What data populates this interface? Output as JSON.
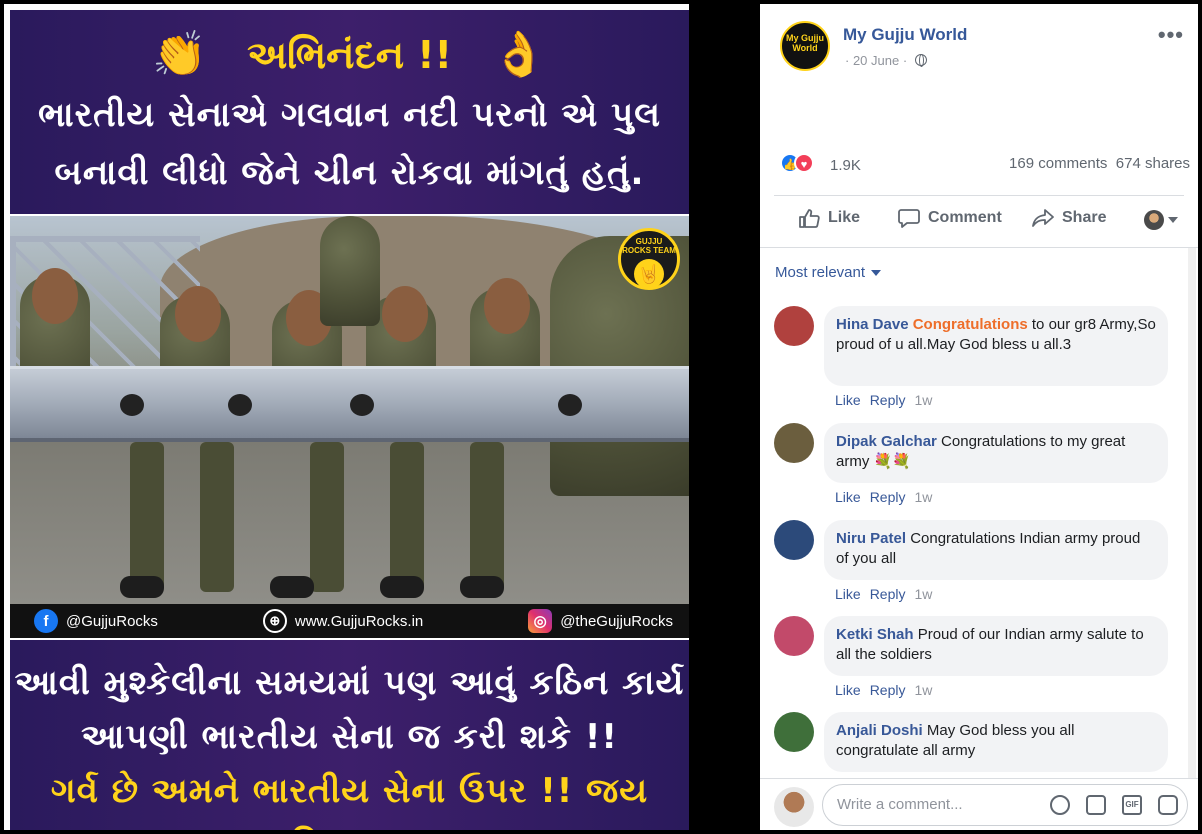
{
  "image": {
    "emoji_left": "👏",
    "emoji_right": "👌",
    "headline": "અભિનંદન !!",
    "line1": "ભારતીય સેનાએ ગલવાન નદી પરનો એ પુલ",
    "line2": "બનાવી લીધો જેને ચીન રોકવા માંગતું હતું.",
    "badge_text": "GUJJU ROCKS TEAM",
    "social_facebook": "@GujjuRocks",
    "social_web": "www.GujjuRocks.in",
    "social_instagram": "@theGujjuRocks",
    "bottom_line1": "આવી મુશ્કેલીના સમયમાં પણ આવું કઠિન કાર્ય",
    "bottom_line2": "આપણી ભારતીય સેના જ કરી શકે !!",
    "bottom_line3": "ગર્વ છે અમને ભારતીય સેના ઉપર !! જય હિન્દ !!"
  },
  "post": {
    "page_avatar_text": "My Gujju World",
    "page_name": "My Gujju World",
    "date": "· 20 June ·",
    "more": "•••",
    "reactions_count": "1.9K",
    "comments_count": "169 comments",
    "shares_count": "674 shares",
    "like_label": "Like",
    "comment_label": "Comment",
    "share_label": "Share"
  },
  "comments": {
    "sort_label": "Most relevant",
    "items": [
      {
        "name": "Hina Dave",
        "highlight": "Congratulations",
        "text": " to our gr8 Army,So proud of u all.May God bless u all.3",
        "like": "Like",
        "reply": "Reply",
        "time": "1w",
        "avatar_color": "#b0413e"
      },
      {
        "name": "Dipak Galchar",
        "highlight": "",
        "text": " Congratulations to my great army 💐💐",
        "like": "Like",
        "reply": "Reply",
        "time": "1w",
        "avatar_color": "#6b5e3e"
      },
      {
        "name": "Niru Patel",
        "highlight": "",
        "text": " Congratulations Indian army proud of you all",
        "like": "Like",
        "reply": "Reply",
        "time": "1w",
        "avatar_color": "#2c4a7a"
      },
      {
        "name": "Ketki Shah",
        "highlight": "",
        "text": " Proud of our Indian army salute to all the soldiers",
        "like": "Like",
        "reply": "Reply",
        "time": "1w",
        "avatar_color": "#c24a6a"
      },
      {
        "name": "Anjali Doshi",
        "highlight": "",
        "text": " May God bless you all congratulate all army",
        "like": "",
        "reply": "",
        "time": "",
        "avatar_color": "#3f6f3a"
      }
    ]
  },
  "composer": {
    "placeholder": "Write a comment...",
    "gif_label": "GIF"
  },
  "colors": {
    "link": "#385898",
    "highlight": "#ee6e2a",
    "banner_bg": "#2a1a5c",
    "accent_yellow": "#ffd31a"
  }
}
